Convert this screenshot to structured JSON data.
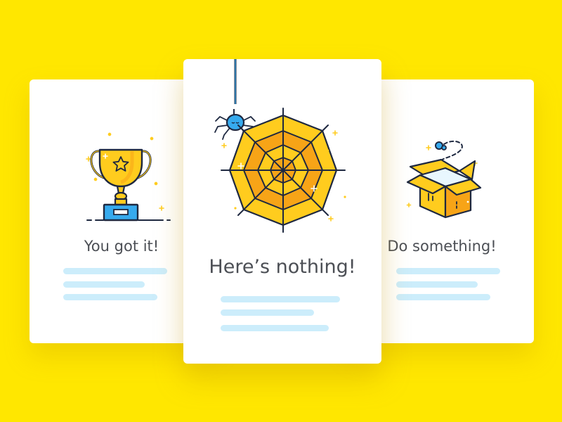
{
  "colors": {
    "background": "#FFE700",
    "card": "#FFFFFF",
    "accent_yellow": "#FFCC1E",
    "accent_orange": "#F7A417",
    "outline": "#1E2840",
    "accent_blue": "#36AAEE",
    "placeholder_line": "#CCEDFB",
    "caption_text": "#4C4F55"
  },
  "cards": {
    "left": {
      "icon": "trophy-icon",
      "caption": "You got it!",
      "placeholder_lines": 3
    },
    "center": {
      "icon": "spider-web-icon",
      "caption": "Here’s nothing!",
      "placeholder_lines": 3
    },
    "right": {
      "icon": "open-box-icon",
      "caption": "Do something!",
      "placeholder_lines": 3
    }
  }
}
